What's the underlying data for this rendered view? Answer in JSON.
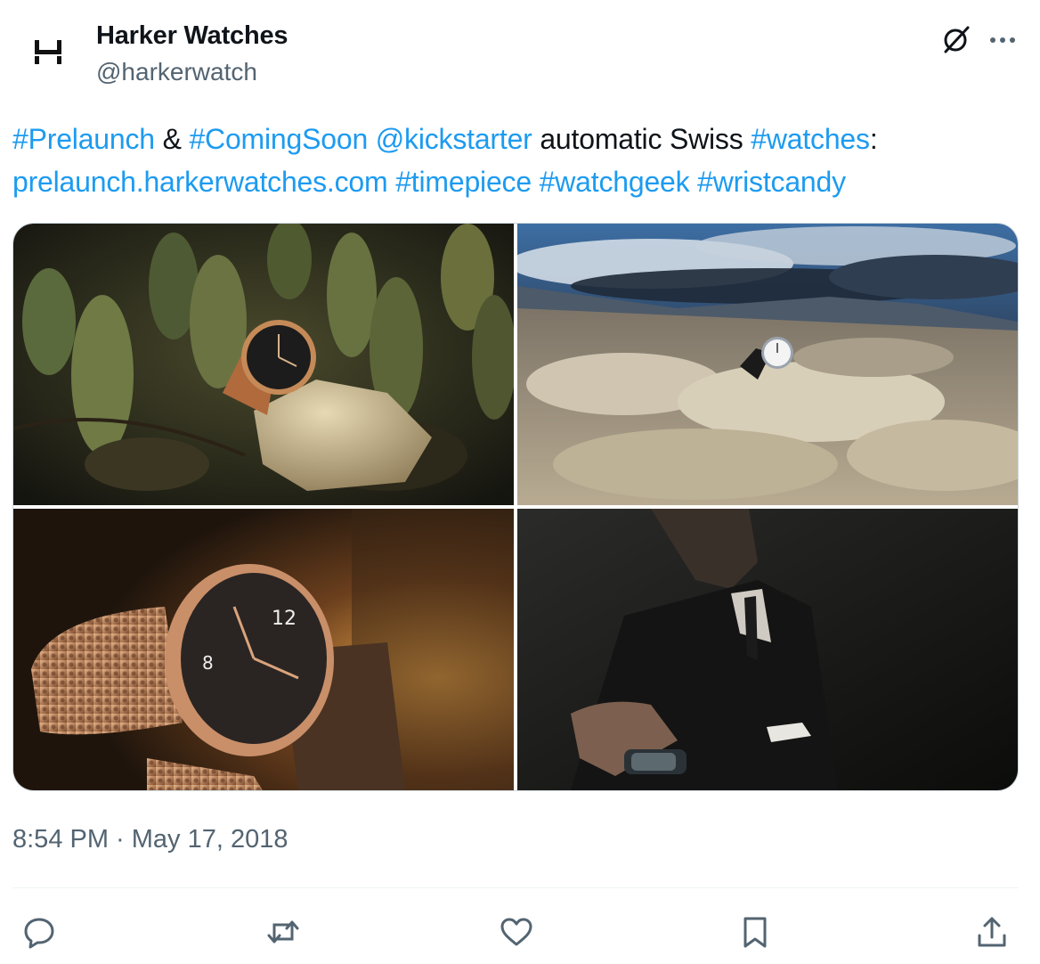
{
  "header": {
    "display_name": "Harker Watches",
    "handle": "@harkerwatch"
  },
  "tweet": {
    "segments": [
      {
        "text": "#Prelaunch",
        "link": true
      },
      {
        "text": " & ",
        "link": false
      },
      {
        "text": "#ComingSoon",
        "link": true
      },
      {
        "text": " ",
        "link": false
      },
      {
        "text": "@kickstarter",
        "link": true
      },
      {
        "text": " automatic Swiss ",
        "link": false
      },
      {
        "text": "#watches",
        "link": true
      },
      {
        "text": ": ",
        "link": false
      },
      {
        "text": "prelaunch.harkerwatches.com",
        "link": true
      },
      {
        "text": "  ",
        "link": false
      },
      {
        "text": "#timepiece",
        "link": true
      },
      {
        "text": " ",
        "link": false
      },
      {
        "text": "#watchgeek",
        "link": true
      },
      {
        "text": " ",
        "link": false
      },
      {
        "text": "#wristcandy",
        "link": true
      }
    ],
    "timestamp": "8:54 PM · May 17, 2018"
  },
  "media": [
    {
      "name": "photo-watch-cactus"
    },
    {
      "name": "photo-watch-salt-flat"
    },
    {
      "name": "photo-watch-mesh-strap"
    },
    {
      "name": "photo-watch-suit"
    }
  ],
  "icons": {
    "grok": "grok-icon",
    "more": "more-icon",
    "reply": "reply-icon",
    "retweet": "retweet-icon",
    "like": "like-icon",
    "bookmark": "bookmark-icon",
    "share": "share-icon"
  },
  "colors": {
    "link": "#1d9bf0",
    "text": "#0f1419",
    "muted": "#536471",
    "border": "#cfd9de"
  }
}
